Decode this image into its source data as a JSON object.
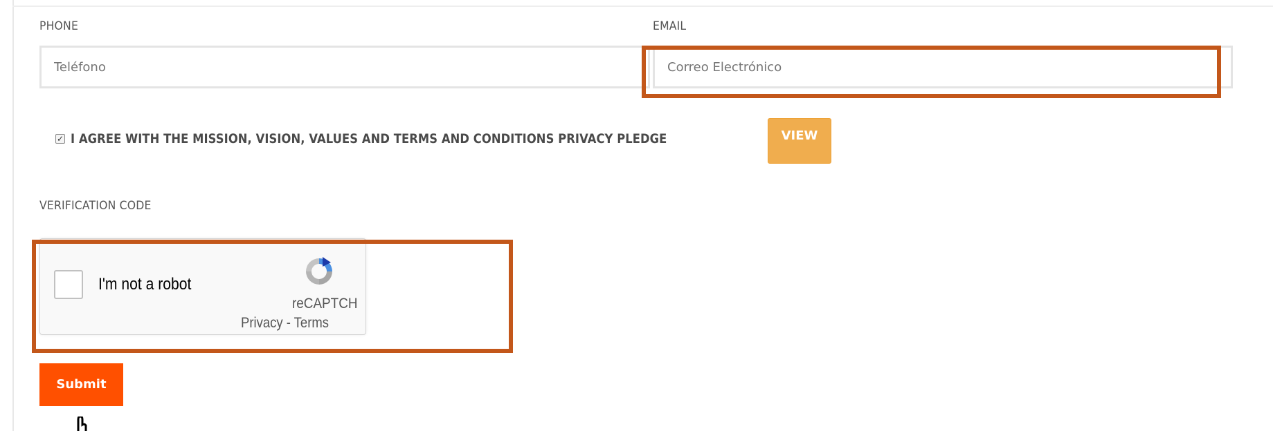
{
  "form": {
    "phone": {
      "label": "PHONE",
      "placeholder": "Teléfono"
    },
    "email": {
      "label": "EMAIL",
      "placeholder": "Correo Electrónico"
    },
    "agreement": {
      "checked": true,
      "text": "I AGREE WITH THE MISSION, VISION, VALUES AND TERMS AND CONDITIONS PRIVACY PLEDGE",
      "view_label": "VIEW"
    },
    "verification": {
      "label": "VERIFICATION CODE",
      "captcha_label": "I'm not a robot",
      "captcha_brand": "reCAPTCH",
      "captcha_links": "Privacy - Terms"
    },
    "submit_label": "Submit"
  },
  "colors": {
    "highlight": "#c3571a",
    "submit": "#ff5000",
    "view_button": "#f0ad4e"
  },
  "icons": {
    "checkbox_checked": "checkbox-checked-icon",
    "recaptcha_logo": "recaptcha-logo-icon",
    "pointer_cursor": "hand-pointer-icon"
  }
}
